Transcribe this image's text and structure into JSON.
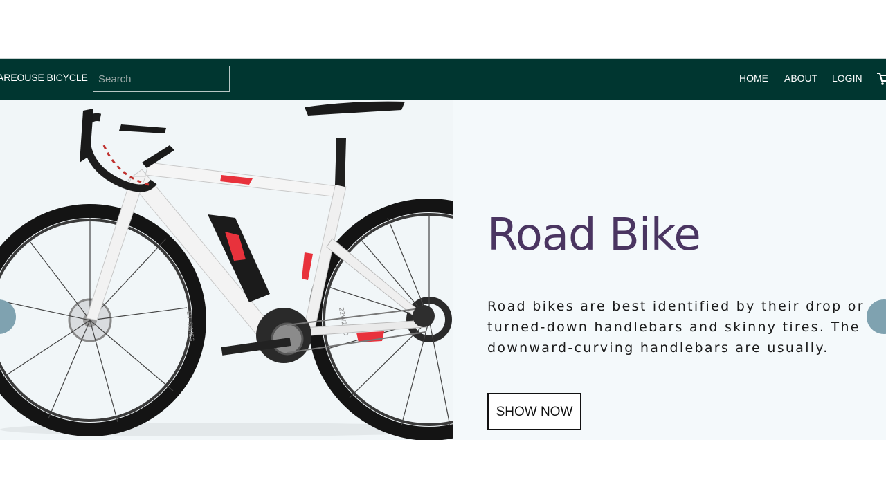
{
  "header": {
    "brand": "AREOUSE BICYCLE",
    "search_placeholder": "Search",
    "search_value": "",
    "nav": {
      "home": "HOME",
      "about": "ABOUT",
      "login": "LOGIN"
    },
    "cart_icon": "cart-icon"
  },
  "hero": {
    "title": "Road Bike",
    "description": "Road bikes are best identified by their drop or turned-down handlebars and skinny tires. The downward-curving handlebars are usually.",
    "button_label": "SHOW NOW"
  },
  "colors": {
    "navbar": "#003630",
    "hero_bg": "#f4f9fb",
    "title": "#4a3561",
    "arrow": "#7fa2b0",
    "bike_accent": "#e8323c"
  }
}
